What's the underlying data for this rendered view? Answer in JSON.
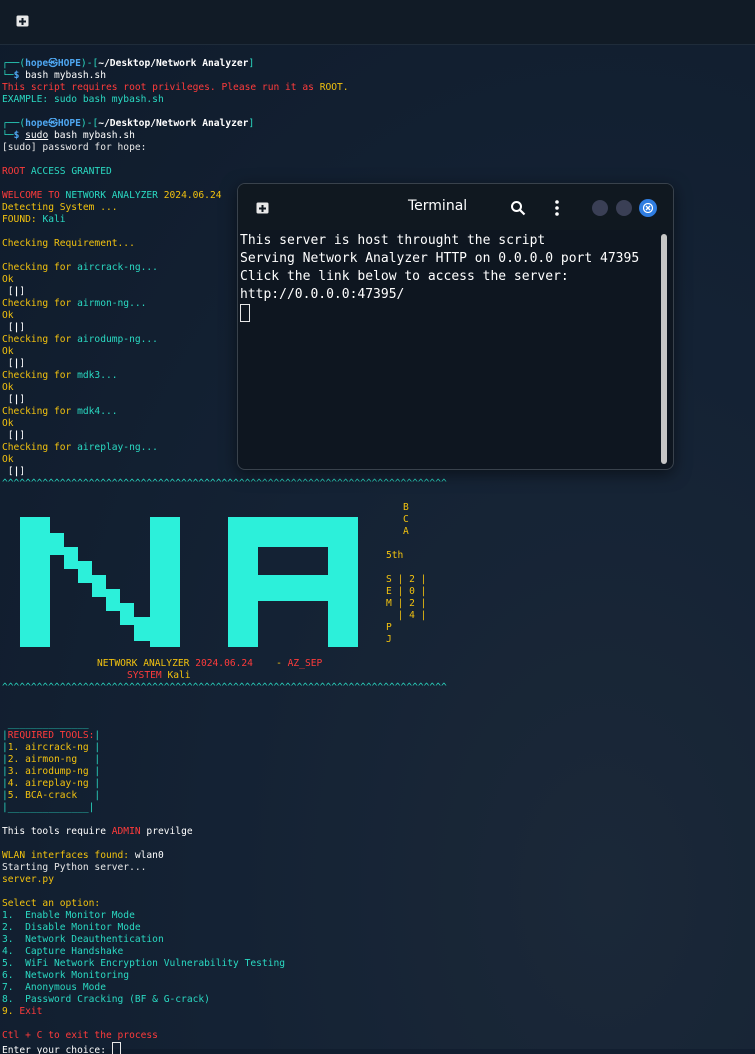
{
  "window": {
    "title": "Terminal",
    "lines": [
      "This server is host throught the script",
      "Serving Network Analyzer HTTP on 0.0.0.0 port 47395",
      "Click the link below to access the server:",
      "http://0.0.0.0:47395/"
    ]
  },
  "prompt": {
    "open": "┌──(",
    "user": "hope",
    "at": "㉿",
    "host": "HOPE",
    "mid": ")-[",
    "path": "~/Desktop/Network Analyzer",
    "close": "]",
    "sym": "└─",
    "dollar": "$ "
  },
  "term": {
    "cmd1": "bash mybash.sh",
    "err1": "This script requires root privileges. Please run it as ",
    "err1_root": "ROOT.",
    "example": "EXAMPLE: sudo bash mybash.sh",
    "sudo": "sudo",
    "cmd2_rest": " bash mybash.sh",
    "sudo_prompt": "[sudo] password for hope:",
    "root_w": "ROOT",
    "access": " ACCESS GRANTED",
    "welcome": "WELCOME TO ",
    "na_title": "NETWORK ANALYZER ",
    "version": "2024.06.24",
    "detecting": "Detecting System ...",
    "found_label": "FOUND: ",
    "found_val": "Kali",
    "checking_req": "Checking Requirement...",
    "check_prefix": "Checking for ",
    "ok": "Ok",
    "bracket": " [",
    "bracket_mid": "|",
    "bracket_end": "]",
    "tools": [
      "aircrack-ng...",
      "airmon-ng...",
      "airodump-ng...",
      "mdk3...",
      "mdk4...",
      "aireplay-ng..."
    ],
    "caret_line": "^^^^^^^^^^^^^^^^^^^^^^^^^^^^^^^^^^^^^^^^^^^^^^^^^^^^^^^^^^^^^^^^^^^^^^^^^^^^^",
    "banner_na": "NETWORK ANALYZER ",
    "banner_ver": "2024.06.24",
    "banner_dash": "    - ",
    "banner_az": "AZ_SEP",
    "banner_system": "SYSTEM ",
    "banner_kali": "Kali",
    "side_bca": [
      "B",
      "C",
      "A"
    ],
    "side_5th": "5th",
    "side_sem": [
      "S | 2 |",
      "E | 0 |",
      "M | 2 |",
      "  | 4 |"
    ],
    "side_pj": [
      "P",
      "J"
    ],
    "box_top": " ______________",
    "box_head": "REQUIRED TOOLS:",
    "box_items": [
      "1. aircrack-ng ",
      "2. airmon-ng   ",
      "3. airodump-ng ",
      "4. aireplay-ng ",
      "5. BCA-crack   "
    ],
    "box_bottom": "______________",
    "admin_pre": "This tools require ",
    "admin": "ADMIN",
    "admin_post": " previlge",
    "wlan_label": "WLAN interfaces found: ",
    "wlan_val": "wlan0",
    "starting": "Starting Python server...",
    "serverpy": "server.py",
    "select": "Select an option:",
    "options": [
      "1.  Enable Monitor Mode",
      "2.  Disable Monitor Mode",
      "3.  Network Deauthentication",
      "4.  Capture Handshake",
      "5.  WiFi Network Encryption Vulnerability Testing",
      "6.  Network Monitoring",
      "7.  Anonymous Mode",
      "8.  Password Cracking (BF & G-crack)"
    ],
    "opt9_num": "9. ",
    "opt9_label": "Exit",
    "ctl": "Ctl + C to exit the process",
    "enter": "Enter your choice: "
  },
  "colors": {
    "accent_teal": "#2ad9c2",
    "prompt_blue": "#4ea6f0",
    "error_red": "#ff3b3b",
    "warn_yellow": "#f2c20f"
  }
}
